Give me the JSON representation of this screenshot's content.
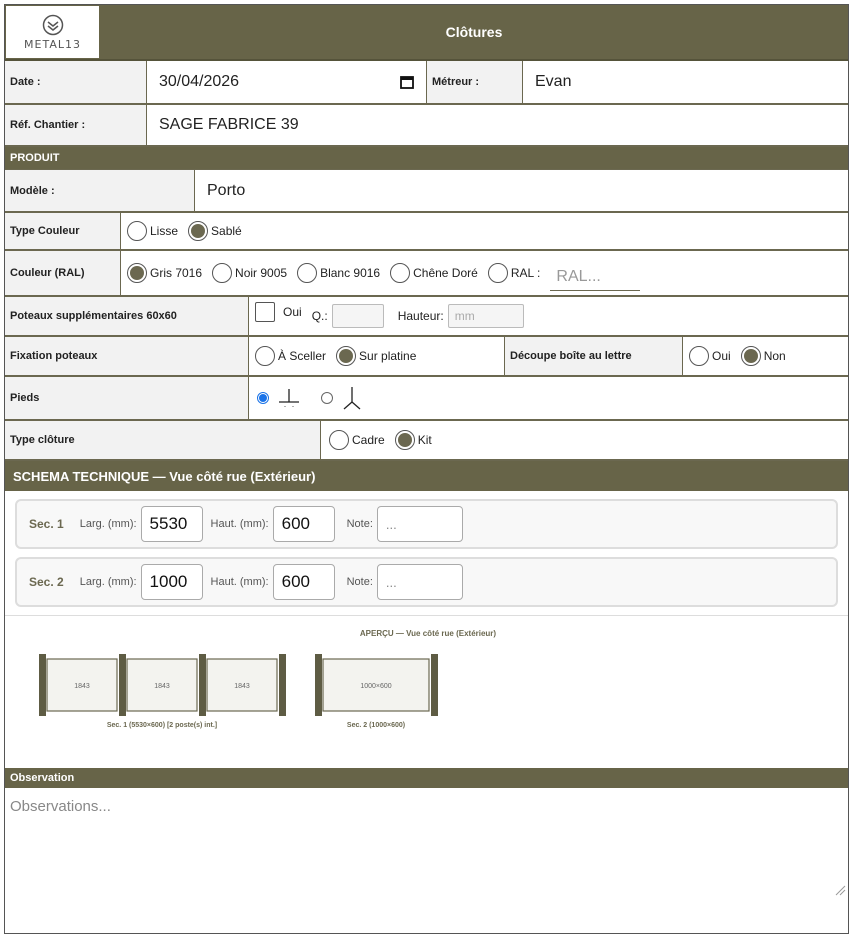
{
  "header": {
    "logo_text": "METAL13",
    "title": "Clôtures"
  },
  "date": {
    "label": "Date :",
    "value": "30/04/2026"
  },
  "metreur": {
    "label": "Métreur :",
    "value": "Evan"
  },
  "ref": {
    "label": "Réf. Chantier :",
    "value": "SAGE FABRICE 39"
  },
  "produit": {
    "section": "PRODUIT",
    "modele_label": "Modèle :",
    "modele_value": "Porto"
  },
  "type_couleur": {
    "label": "Type Couleur",
    "options": [
      "Lisse",
      "Sablé"
    ],
    "selected": "Sablé"
  },
  "couleur": {
    "label": "Couleur (RAL)",
    "options": [
      "Gris 7016",
      "Noir 9005",
      "Blanc 9016",
      "Chêne Doré",
      "RAL :"
    ],
    "selected": "Gris 7016",
    "ral_placeholder": "RAL..."
  },
  "poteaux": {
    "label": "Poteaux supplémentaires 60x60",
    "oui": "Oui",
    "q_label": "Q.:",
    "hauteur_label": "Hauteur:",
    "hauteur_placeholder": "mm"
  },
  "fixation": {
    "label": "Fixation poteaux",
    "options": [
      "À Sceller",
      "Sur platine"
    ],
    "selected": "Sur platine"
  },
  "decoupe": {
    "label": "Découpe boîte au lettre",
    "options": [
      "Oui",
      "Non"
    ],
    "selected": "Non"
  },
  "pieds": {
    "label": "Pieds",
    "selected_index": 0
  },
  "type_cloture": {
    "label": "Type clôture",
    "options": [
      "Cadre",
      "Kit"
    ],
    "selected": "Kit"
  },
  "schema": {
    "title": "SCHEMA TECHNIQUE — Vue côté rue (Extérieur)",
    "larg_label": "Larg. (mm):",
    "haut_label": "Haut. (mm):",
    "note_label": "Note:",
    "sections": [
      {
        "name": "Sec. 1",
        "larg": "5530",
        "haut": "600",
        "note": "..."
      },
      {
        "name": "Sec. 2",
        "larg": "1000",
        "haut": "600",
        "note": "..."
      }
    ]
  },
  "apercu": {
    "title": "APERÇU — Vue côté rue (Extérieur)",
    "sec1_panels": [
      "1843",
      "1843",
      "1843"
    ],
    "sec1_caption": "Sec. 1 (5530×600) [2 poste(s) int.]",
    "sec2_panel": "1000×600",
    "sec2_caption": "Sec. 2 (1000×600)"
  },
  "observation": {
    "label": "Observation",
    "placeholder": "Observations..."
  },
  "colors": {
    "brand": "#676448",
    "accent": "#6b6850"
  }
}
